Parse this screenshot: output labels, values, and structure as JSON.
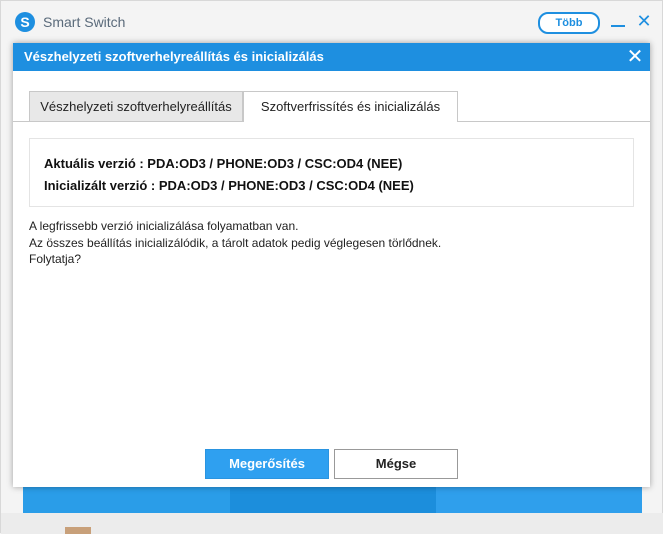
{
  "app": {
    "title": "Smart Switch",
    "logo_letter": "S",
    "more_label": "Több",
    "minimize_icon": "minimize-icon",
    "close_icon": "close-icon",
    "close_glyph": "✕",
    "brand_color": "#1e8fe0"
  },
  "dialog": {
    "title": "Vészhelyzeti szoftverhelyreállítás és inicializálás",
    "close_glyph": "✕",
    "tabs": [
      {
        "label": "Vészhelyzeti szoftverhelyreállítás",
        "selected": false
      },
      {
        "label": "Szoftverfrissítés és inicializálás",
        "selected": true
      }
    ],
    "info": {
      "current_version": "Aktuális verzió : PDA:OD3 / PHONE:OD3 / CSC:OD4 (NEE)",
      "initialized_version": "Inicializált verzió : PDA:OD3 / PHONE:OD3 / CSC:OD4 (NEE)"
    },
    "messages": [
      "A legfrissebb verzió inicializálása folyamatban van.",
      "Az összes beállítás inicializálódik, a tárolt adatok pedig véglegesen törlődnek.",
      "Folytatja?"
    ],
    "confirm_label": "Megerősítés",
    "cancel_label": "Mégse"
  }
}
